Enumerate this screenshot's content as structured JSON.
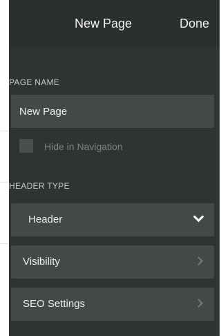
{
  "header": {
    "title": "New Page",
    "done_label": "Done"
  },
  "page_name": {
    "section_label": "PAGE NAME",
    "value": "New Page"
  },
  "hide_in_navigation": {
    "label": "Hide in Navigation",
    "checked": false
  },
  "header_type": {
    "section_label": "HEADER TYPE",
    "selected": "Header"
  },
  "menu": {
    "visibility_label": "Visibility",
    "seo_label": "SEO Settings"
  },
  "icons": {
    "dropdown": "chevron-down-icon",
    "disclosure": "chevron-right-icon"
  },
  "colors": {
    "panel_background": "#2f3334",
    "row_background": "#444849",
    "text": "#eeeeee",
    "muted_text": "#7d8283"
  }
}
